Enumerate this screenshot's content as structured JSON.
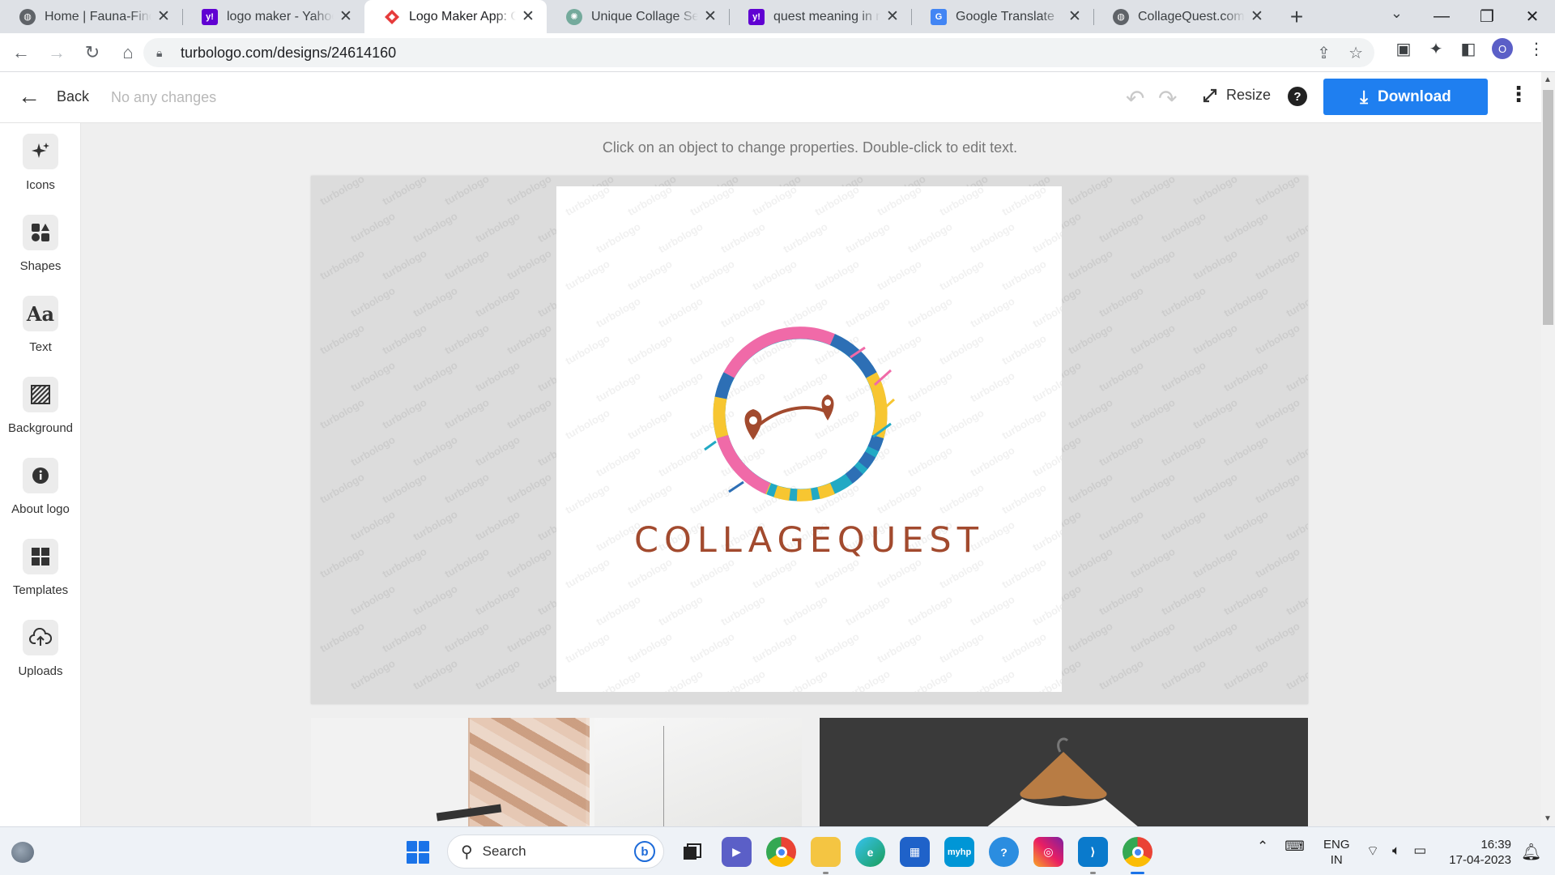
{
  "browser": {
    "tabs": [
      {
        "title": "Home | Fauna-Finder.",
        "favicon": "globe-icon",
        "color": "#5f6368"
      },
      {
        "title": "logo maker - Yahoo In",
        "favicon": "yahoo-icon",
        "color": "#6001d2"
      },
      {
        "title": "Logo Maker App: Get",
        "favicon": "turbologo-icon",
        "color": "#e63b3b"
      },
      {
        "title": "Unique Collage Search",
        "favicon": "chatgpt-icon",
        "color": "#74aa9c"
      },
      {
        "title": "quest meaning in mar",
        "favicon": "yahoo-icon",
        "color": "#6001d2"
      },
      {
        "title": "Google Translate",
        "favicon": "translate-icon",
        "color": "#4285f4"
      },
      {
        "title": "CollageQuest.com",
        "favicon": "globe-icon",
        "color": "#5f6368"
      }
    ],
    "active_tab": 2,
    "url": "turbologo.com/designs/24614160",
    "profile_initial": "O"
  },
  "appbar": {
    "back_label": "Back",
    "status": "No any changes",
    "resize_label": "Resize",
    "download_label": "Download",
    "accent": "#1f7ff0"
  },
  "sidebar": {
    "items": [
      {
        "label": "Icons",
        "icon": "sparkle-icon"
      },
      {
        "label": "Shapes",
        "icon": "shapes-icon"
      },
      {
        "label": "Text",
        "icon": "text-icon"
      },
      {
        "label": "Background",
        "icon": "background-icon"
      },
      {
        "label": "About logo",
        "icon": "info-icon"
      },
      {
        "label": "Templates",
        "icon": "templates-icon"
      },
      {
        "label": "Uploads",
        "icon": "upload-cloud-icon"
      }
    ]
  },
  "canvas": {
    "hint": "Click on an object to change properties. Double-click to edit text.",
    "watermark": "turbologo",
    "logo": {
      "name": "COLLAGEQUEST",
      "text_color": "#a24a2e",
      "ring_colors": [
        "#f06aa8",
        "#2d6fb5",
        "#f7c631",
        "#22a9c4"
      ]
    }
  },
  "taskbar": {
    "search_placeholder": "Search",
    "language_line1": "ENG",
    "language_line2": "IN",
    "time": "16:39",
    "date": "17-04-2023"
  }
}
